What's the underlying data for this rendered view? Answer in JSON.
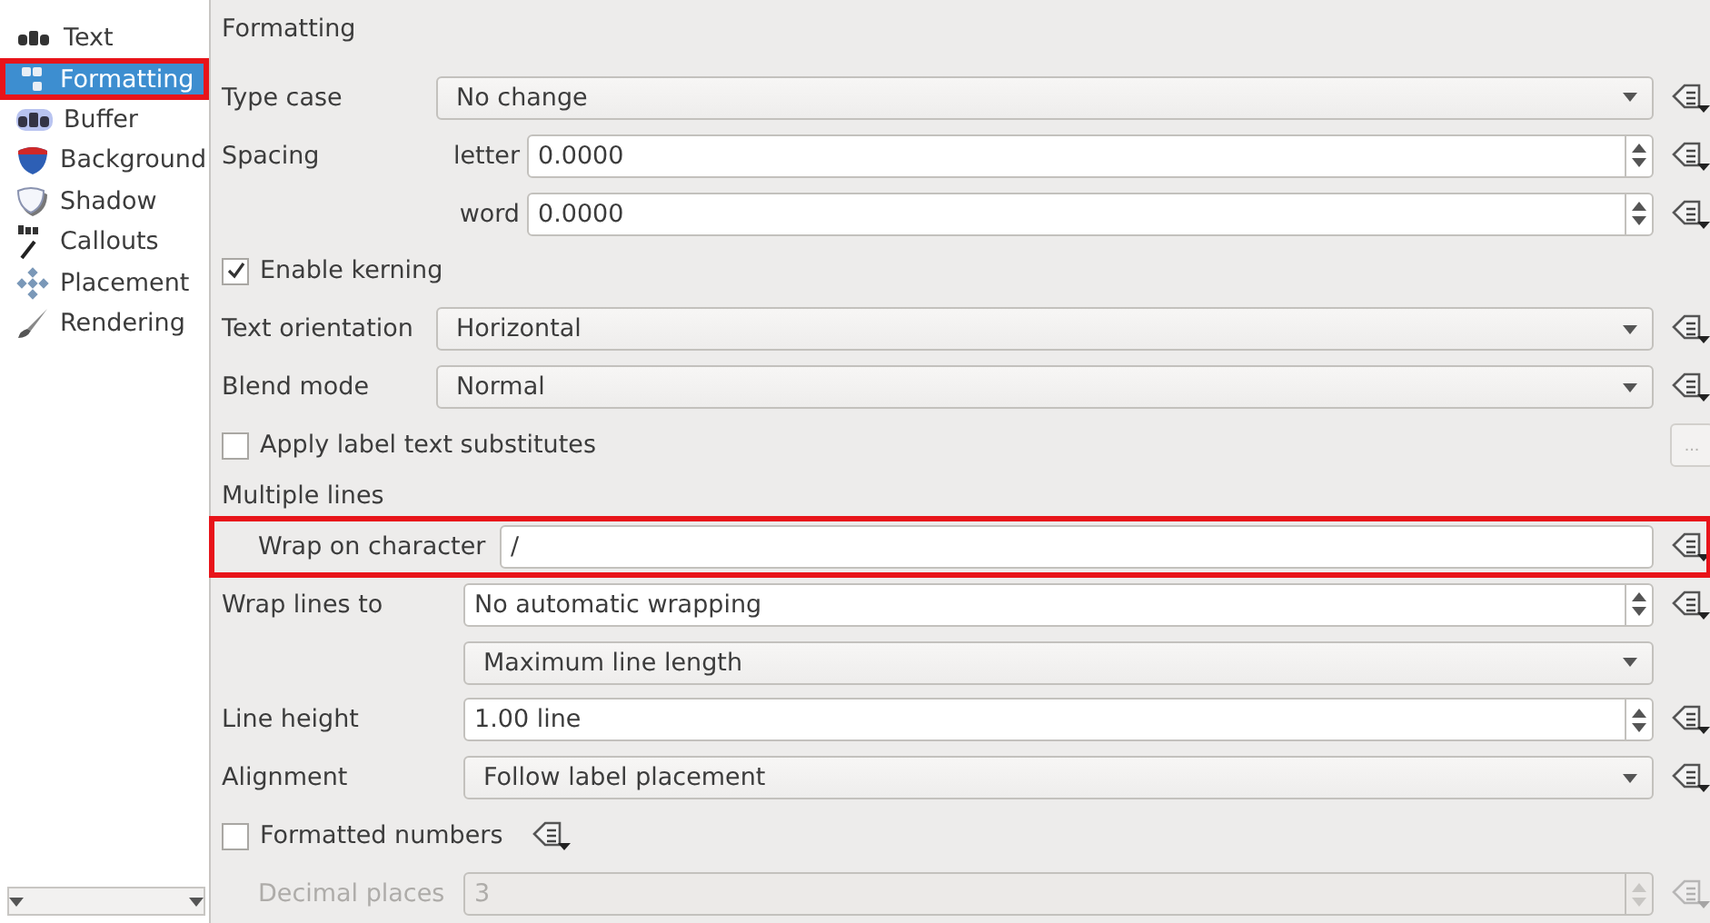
{
  "sidebar": {
    "items": [
      {
        "label": "Text",
        "selected": false,
        "highlighted": false
      },
      {
        "label": "Formatting",
        "selected": true,
        "highlighted": true
      },
      {
        "label": "Buffer",
        "selected": false,
        "highlighted": false
      },
      {
        "label": "Background",
        "selected": false,
        "highlighted": false
      },
      {
        "label": "Shadow",
        "selected": false,
        "highlighted": false
      },
      {
        "label": "Callouts",
        "selected": false,
        "highlighted": false
      },
      {
        "label": "Placement",
        "selected": false,
        "highlighted": false
      },
      {
        "label": "Rendering",
        "selected": false,
        "highlighted": false
      }
    ]
  },
  "heading": "Formatting",
  "rows": [
    {
      "kind": "combo",
      "label": "Type case",
      "value": "No change"
    },
    {
      "kind": "spin",
      "label": "Spacing",
      "sublabel": "letter",
      "value": "0.0000"
    },
    {
      "kind": "spin",
      "sublabel": "word",
      "value": "0.0000"
    },
    {
      "kind": "check",
      "label": "Enable kerning",
      "checked": true
    },
    {
      "kind": "combo",
      "label": "Text orientation",
      "value": "Horizontal"
    },
    {
      "kind": "combo",
      "label": "Blend mode",
      "value": "Normal"
    },
    {
      "kind": "check",
      "label": "Apply label text substitutes",
      "checked": false,
      "button": "..."
    },
    {
      "kind": "group",
      "label": "Multiple lines",
      "children": [
        {
          "kind": "text",
          "label": "Wrap on character",
          "value": "/",
          "highlighted": true
        },
        {
          "kind": "spin",
          "label": "Wrap lines to",
          "value": "No automatic wrapping"
        },
        {
          "kind": "subcombo",
          "value": "Maximum line length"
        },
        {
          "kind": "spin",
          "label": "Line height",
          "value": "1.00 line"
        },
        {
          "kind": "combo",
          "label": "Alignment",
          "value": "Follow label placement"
        }
      ]
    },
    {
      "kind": "check_dd",
      "label": "Formatted numbers",
      "checked": false
    },
    {
      "kind": "subspin",
      "label": "Decimal places",
      "value": "3",
      "disabled": true
    }
  ]
}
